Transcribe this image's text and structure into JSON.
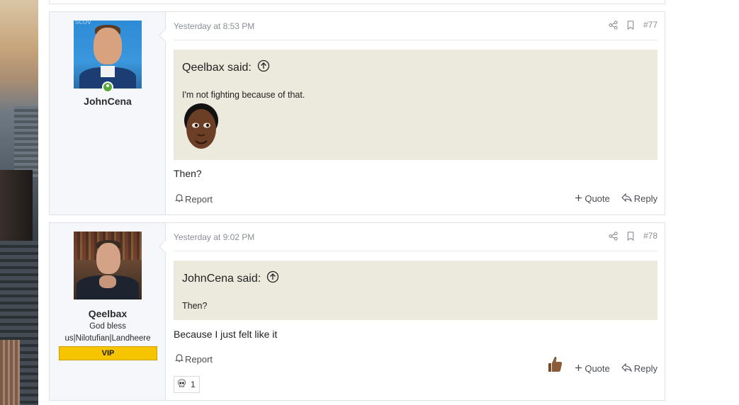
{
  "posts": [
    {
      "username": "JohnCena",
      "online": true,
      "date": "Yesterday at 8:53 PM",
      "post_number": "#77",
      "quote": {
        "author_label": "Qeelbax said:",
        "text": "I'm not fighting because of that."
      },
      "message": "Then?",
      "actions": {
        "report": "Report",
        "quote": "Quote",
        "reply": "Reply"
      }
    },
    {
      "username": "Qeelbax",
      "user_title": "God bless us|Nilotufian|Landheere",
      "badge": "VIP",
      "date": "Yesterday at 9:02 PM",
      "post_number": "#78",
      "quote": {
        "author_label": "JohnCena said:",
        "text": "Then?"
      },
      "message": "Because I just felt like it",
      "actions": {
        "report": "Report",
        "quote": "Quote",
        "reply": "Reply"
      },
      "reaction": {
        "icon": "skull-icon",
        "count": "1"
      }
    }
  ],
  "icons": {
    "share": "share-icon",
    "bookmark": "bookmark-icon",
    "expand_quote": "arrow-up-circle-icon",
    "report": "bell-icon",
    "reply": "reply-arrow-icon",
    "thumbs_up": "thumbs-up-icon"
  },
  "colors": {
    "quote_bg": "#ece9dd",
    "vip_badge": "#f7c400",
    "online": "#58a93b",
    "user_col_bg": "#f5f7fa"
  }
}
